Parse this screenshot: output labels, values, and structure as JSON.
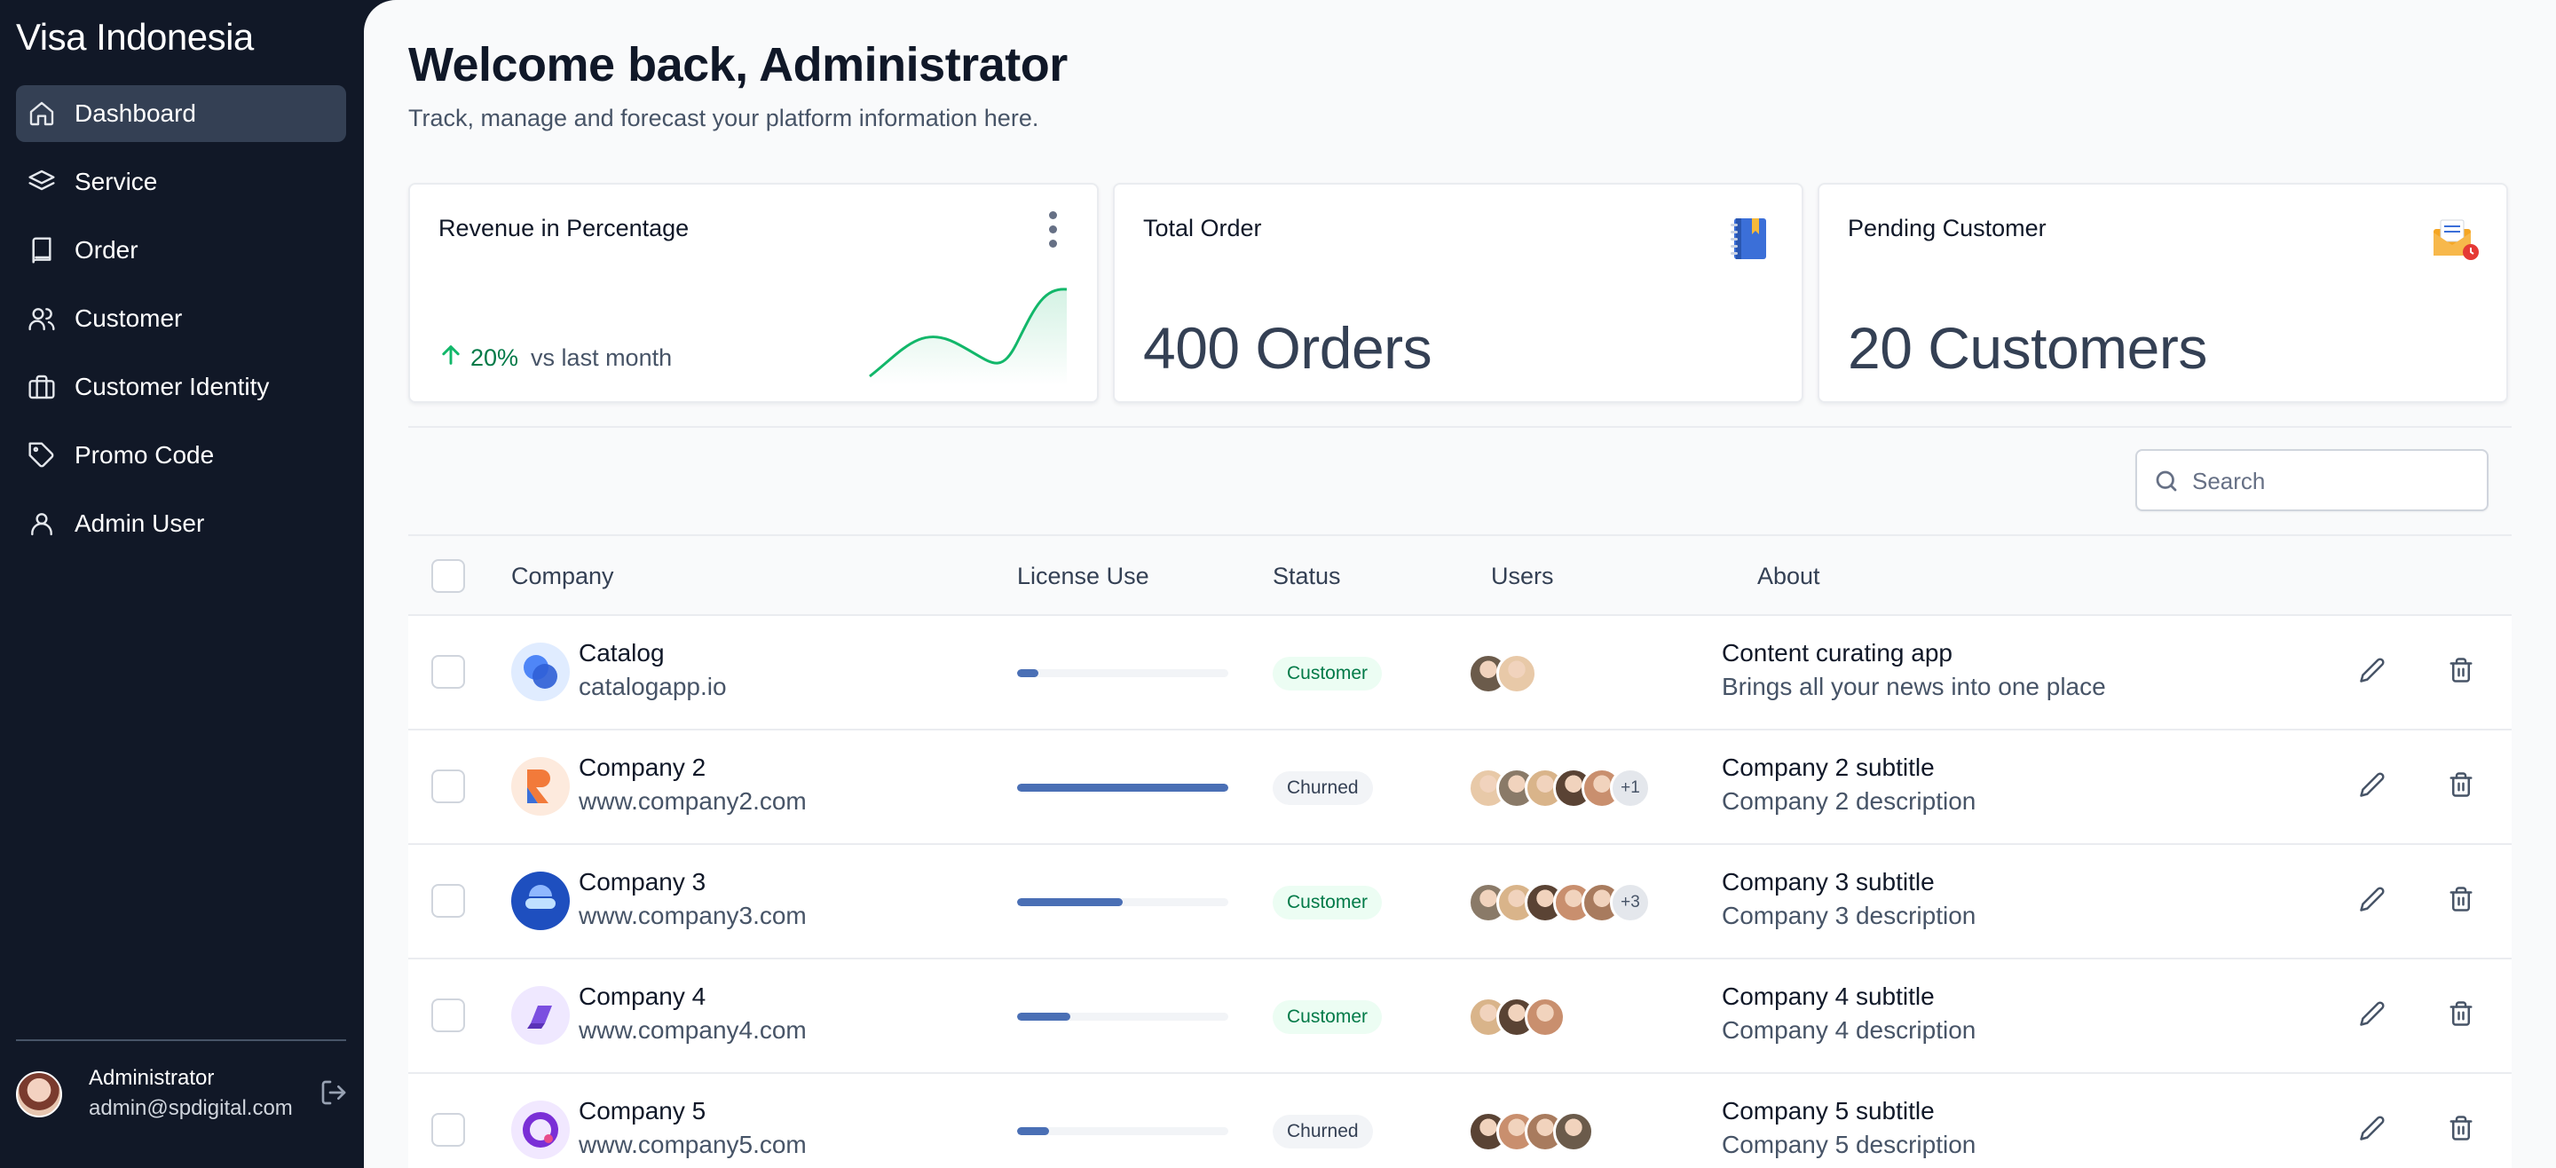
{
  "sidebar": {
    "brand": "Visa Indonesia",
    "items": [
      {
        "label": "Dashboard",
        "icon": "home-icon",
        "active": true
      },
      {
        "label": "Service",
        "icon": "layers-icon"
      },
      {
        "label": "Order",
        "icon": "book-icon"
      },
      {
        "label": "Customer",
        "icon": "users-icon"
      },
      {
        "label": "Customer Identity",
        "icon": "briefcase-icon"
      },
      {
        "label": "Promo Code",
        "icon": "tag-icon"
      },
      {
        "label": "Admin User",
        "icon": "user-icon"
      }
    ],
    "profile": {
      "name": "Administrator",
      "email": "admin@spdigital.com"
    }
  },
  "header": {
    "title": "Welcome back, Administrator",
    "subtitle": "Track, manage and forecast your platform information here."
  },
  "cards": [
    {
      "title": "Revenue in Percentage",
      "trend_value": "20%",
      "trend_label": "vs last month",
      "trend_direction": "up"
    },
    {
      "title": "Total Order",
      "value": "400 Orders",
      "icon": "notebook-icon"
    },
    {
      "title": "Pending Customer",
      "value": "20 Customers",
      "icon": "mail-pending-icon"
    }
  ],
  "search": {
    "placeholder": "Search"
  },
  "table": {
    "headers": {
      "company": "Company",
      "license": "License Use",
      "status": "Status",
      "users": "Users",
      "about": "About"
    },
    "rows": [
      {
        "name": "Catalog",
        "site": "catalogapp.io",
        "license": 0.1,
        "status": "Customer",
        "status_type": "customer",
        "users": 2,
        "more": "",
        "subtitle": "Content curating app",
        "description": "Brings all your news into one place",
        "logo": "catalog"
      },
      {
        "name": "Company 2",
        "site": "www.company2.com",
        "license": 1.0,
        "status": "Churned",
        "status_type": "churned",
        "users": 5,
        "more": "+1",
        "subtitle": "Company 2 subtitle",
        "description": "Company 2 description",
        "logo": "c2"
      },
      {
        "name": "Company 3",
        "site": "www.company3.com",
        "license": 0.5,
        "status": "Customer",
        "status_type": "customer",
        "users": 5,
        "more": "+3",
        "subtitle": "Company 3 subtitle",
        "description": "Company 3 description",
        "logo": "c3"
      },
      {
        "name": "Company 4",
        "site": "www.company4.com",
        "license": 0.25,
        "status": "Customer",
        "status_type": "customer",
        "users": 3,
        "more": "",
        "subtitle": "Company 4 subtitle",
        "description": "Company 4 description",
        "logo": "c4"
      },
      {
        "name": "Company 5",
        "site": "www.company5.com",
        "license": 0.15,
        "status": "Churned",
        "status_type": "churned",
        "users": 4,
        "more": "",
        "subtitle": "Company 5 subtitle",
        "description": "Company 5 description",
        "logo": "c5"
      }
    ]
  },
  "colors": {
    "sidebar_bg": "#111827",
    "active_item": "#344054",
    "accent": "#4a6fb5",
    "positive": "#12b76a"
  }
}
